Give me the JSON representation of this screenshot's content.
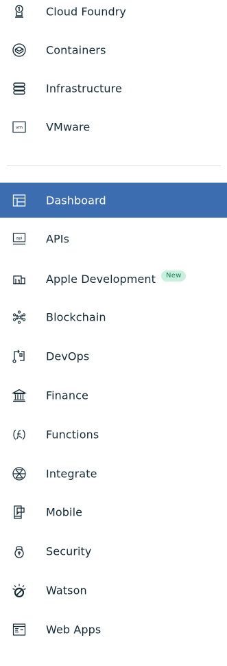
{
  "menu": {
    "top_items": [
      {
        "label": "Cloud Foundry",
        "icon": "cloud-foundry-icon"
      },
      {
        "label": "Containers",
        "icon": "containers-icon"
      },
      {
        "label": "Infrastructure",
        "icon": "infrastructure-icon"
      },
      {
        "label": "VMware",
        "icon": "vmware-icon",
        "icon_text": "vm"
      }
    ],
    "items": [
      {
        "label": "Dashboard",
        "icon": "dashboard-icon",
        "active": true
      },
      {
        "label": "APIs",
        "icon": "api-icon",
        "icon_text": "api"
      },
      {
        "label": "Apple Development",
        "icon": "apple-development-icon",
        "badge": "New"
      },
      {
        "label": "Blockchain",
        "icon": "blockchain-icon"
      },
      {
        "label": "DevOps",
        "icon": "devops-icon"
      },
      {
        "label": "Finance",
        "icon": "finance-icon"
      },
      {
        "label": "Functions",
        "icon": "functions-icon"
      },
      {
        "label": "Integrate",
        "icon": "integrate-icon"
      },
      {
        "label": "Mobile",
        "icon": "mobile-icon"
      },
      {
        "label": "Security",
        "icon": "security-icon"
      },
      {
        "label": "Watson",
        "icon": "watson-icon"
      },
      {
        "label": "Web Apps",
        "icon": "web-apps-icon"
      }
    ]
  },
  "colors": {
    "active_bg": "#3c6db1",
    "text": "#152935",
    "badge_bg": "#c8f0df",
    "badge_text": "#1b7a55"
  }
}
